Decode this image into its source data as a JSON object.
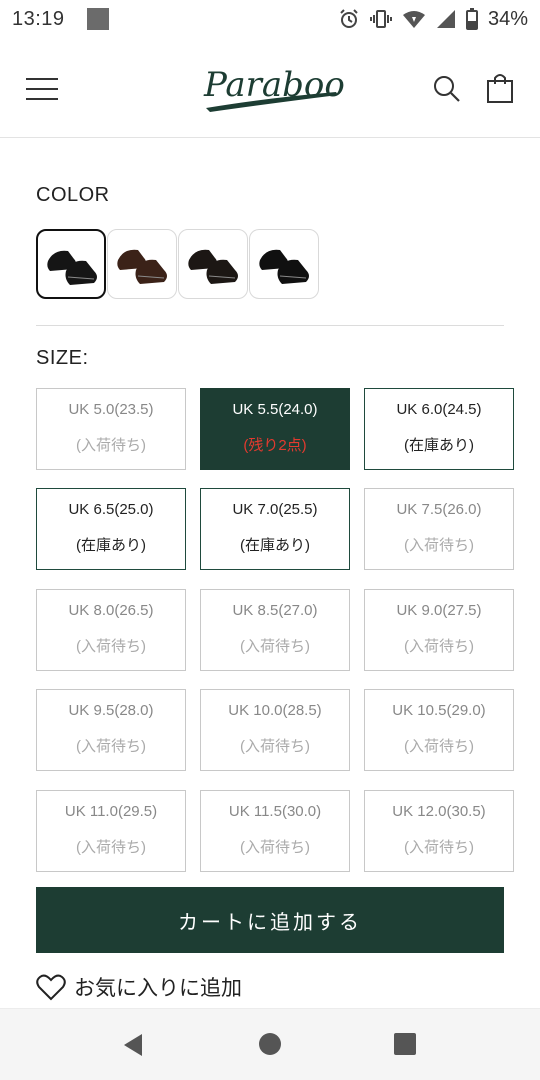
{
  "status_bar": {
    "time": "13:19",
    "battery": "34%"
  },
  "header": {
    "logo_text": "Paraboot"
  },
  "color": {
    "title": "COLOR",
    "swatches": [
      {
        "tone": "#151515",
        "selected": true
      },
      {
        "tone": "#3b2218",
        "selected": false
      },
      {
        "tone": "#1c1714",
        "selected": false
      },
      {
        "tone": "#101010",
        "selected": false
      }
    ]
  },
  "size": {
    "title": "SIZE:",
    "items": [
      {
        "label": "UK 5.0(23.5)",
        "status": "(入荷待ち)",
        "state": "waiting"
      },
      {
        "label": "UK 5.5(24.0)",
        "status": "(残り2点)",
        "state": "selected"
      },
      {
        "label": "UK 6.0(24.5)",
        "status": "(在庫あり)",
        "state": "instock"
      },
      {
        "label": "UK 6.5(25.0)",
        "status": "(在庫あり)",
        "state": "instock"
      },
      {
        "label": "UK 7.0(25.5)",
        "status": "(在庫あり)",
        "state": "instock"
      },
      {
        "label": "UK 7.5(26.0)",
        "status": "(入荷待ち)",
        "state": "waiting"
      },
      {
        "label": "UK 8.0(26.5)",
        "status": "(入荷待ち)",
        "state": "waiting"
      },
      {
        "label": "UK 8.5(27.0)",
        "status": "(入荷待ち)",
        "state": "waiting"
      },
      {
        "label": "UK 9.0(27.5)",
        "status": "(入荷待ち)",
        "state": "waiting"
      },
      {
        "label": "UK 9.5(28.0)",
        "status": "(入荷待ち)",
        "state": "waiting"
      },
      {
        "label": "UK 10.0(28.5)",
        "status": "(入荷待ち)",
        "state": "waiting"
      },
      {
        "label": "UK 10.5(29.0)",
        "status": "(入荷待ち)",
        "state": "waiting"
      },
      {
        "label": "UK 11.0(29.5)",
        "status": "(入荷待ち)",
        "state": "waiting"
      },
      {
        "label": "UK 11.5(30.0)",
        "status": "(入荷待ち)",
        "state": "waiting"
      },
      {
        "label": "UK 12.0(30.5)",
        "status": "(入荷待ち)",
        "state": "waiting"
      }
    ]
  },
  "actions": {
    "add_to_cart": "カートに追加する",
    "add_to_favorites": "お気に入りに追加"
  },
  "colors": {
    "brand_green": "#1d3d33",
    "stock_red": "#e23a2f"
  }
}
